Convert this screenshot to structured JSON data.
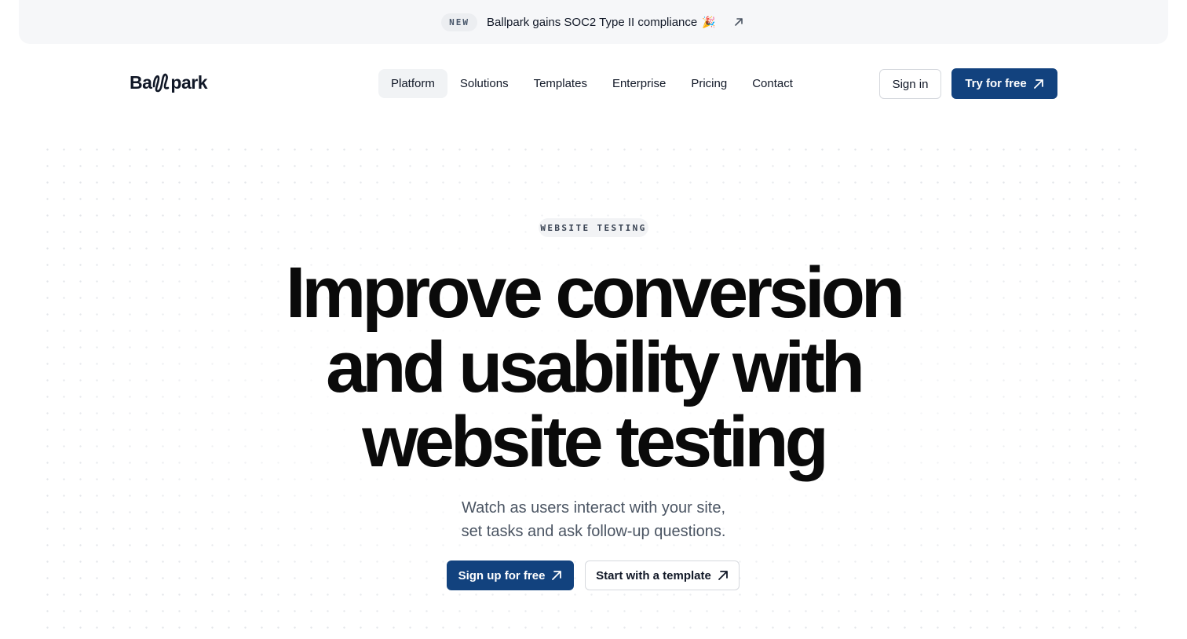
{
  "announcement": {
    "badge": "NEW",
    "text": "Ballpark gains SOC2 Type II compliance",
    "emoji": "🎉",
    "icon": "external-arrow-icon"
  },
  "header": {
    "logo": {
      "prefix": "Ba",
      "suffix": "park"
    },
    "nav": [
      {
        "label": "Platform",
        "active": true
      },
      {
        "label": "Solutions"
      },
      {
        "label": "Templates"
      },
      {
        "label": "Enterprise"
      },
      {
        "label": "Pricing"
      },
      {
        "label": "Contact"
      }
    ],
    "sign_in": "Sign in",
    "try_free": "Try for free"
  },
  "hero": {
    "eyebrow": "WEBSITE TESTING",
    "headline": [
      "Improve conversion",
      "and usability with",
      "website testing"
    ],
    "subhead": [
      "Watch as users interact with your site,",
      "set tasks and ask follow-up questions."
    ],
    "cta_primary": "Sign up for free",
    "cta_secondary": "Start with a template"
  },
  "colors": {
    "brand_blue": "#12427e",
    "announce_bg": "#f6f7f9",
    "text_dark": "#0a0a0a",
    "text_muted": "#4b5563"
  }
}
